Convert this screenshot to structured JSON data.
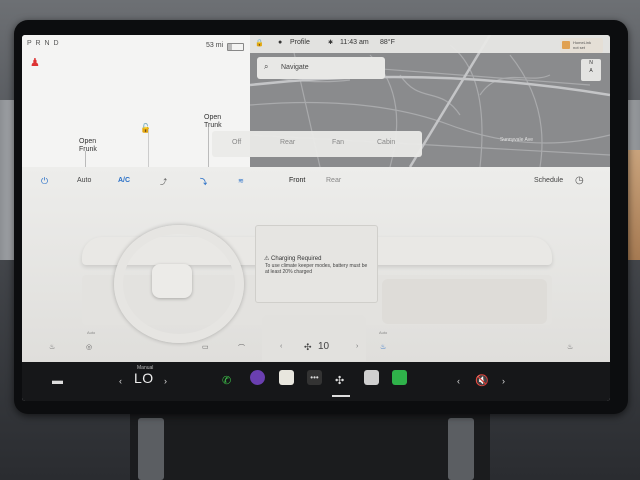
{
  "car": {
    "gear": "P R N D",
    "range": "53 mi",
    "battery_fraction": 0.25,
    "frunk_label": "Open\nFrunk",
    "trunk_label": "Open\nTrunk"
  },
  "map": {
    "profile": "Profile",
    "time": "11:43 am",
    "temp": "88°F",
    "navigate_placeholder": "Navigate",
    "homelink_label": "HomeLink\nnot set",
    "compass": "N\nA",
    "road_label": "Sunnyvale Ave"
  },
  "fan_popup": {
    "options": [
      "Off",
      "Rear",
      "Fan",
      "Cabin"
    ]
  },
  "climate": {
    "auto": "Auto",
    "ac": "A/C",
    "front": "Front",
    "rear": "Rear",
    "schedule": "Schedule",
    "charging_title": "Charging Required",
    "charging_msg": "To use climate keeper modes, battery must be at least 20% charged",
    "auto_small_left": "Auto",
    "auto_small_right": "Auto",
    "fan_speed": "10"
  },
  "dock": {
    "temp_mode": "Manual",
    "temp_value": "LO"
  },
  "colors": {
    "accent": "#2a70c7",
    "dock_bg": "#161719",
    "screen_bg": "#f2f2f0"
  }
}
